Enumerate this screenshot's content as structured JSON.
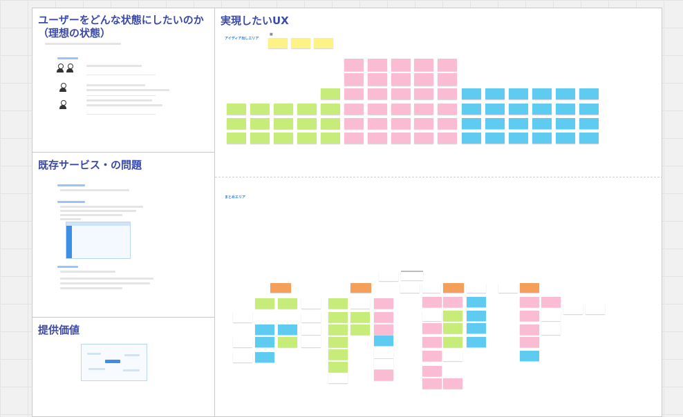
{
  "frames": {
    "ideal_title": "ユーザーをどんな状態にしたいのか（理想の状態）",
    "problems_title": "既存サービス・の問題",
    "value_title": "提供価値",
    "ux_title": "実現したいUX"
  },
  "ux": {
    "idea_area_label": "アイディア出しエリア",
    "summary_area_label": "まとめエリア"
  },
  "colors": {
    "title": "#3b4aa6",
    "green": "#c7ec7a",
    "pink": "#f9bcd2",
    "blue": "#5fcbf1",
    "yellow": "#fdf285",
    "orange": "#f4a05a"
  }
}
